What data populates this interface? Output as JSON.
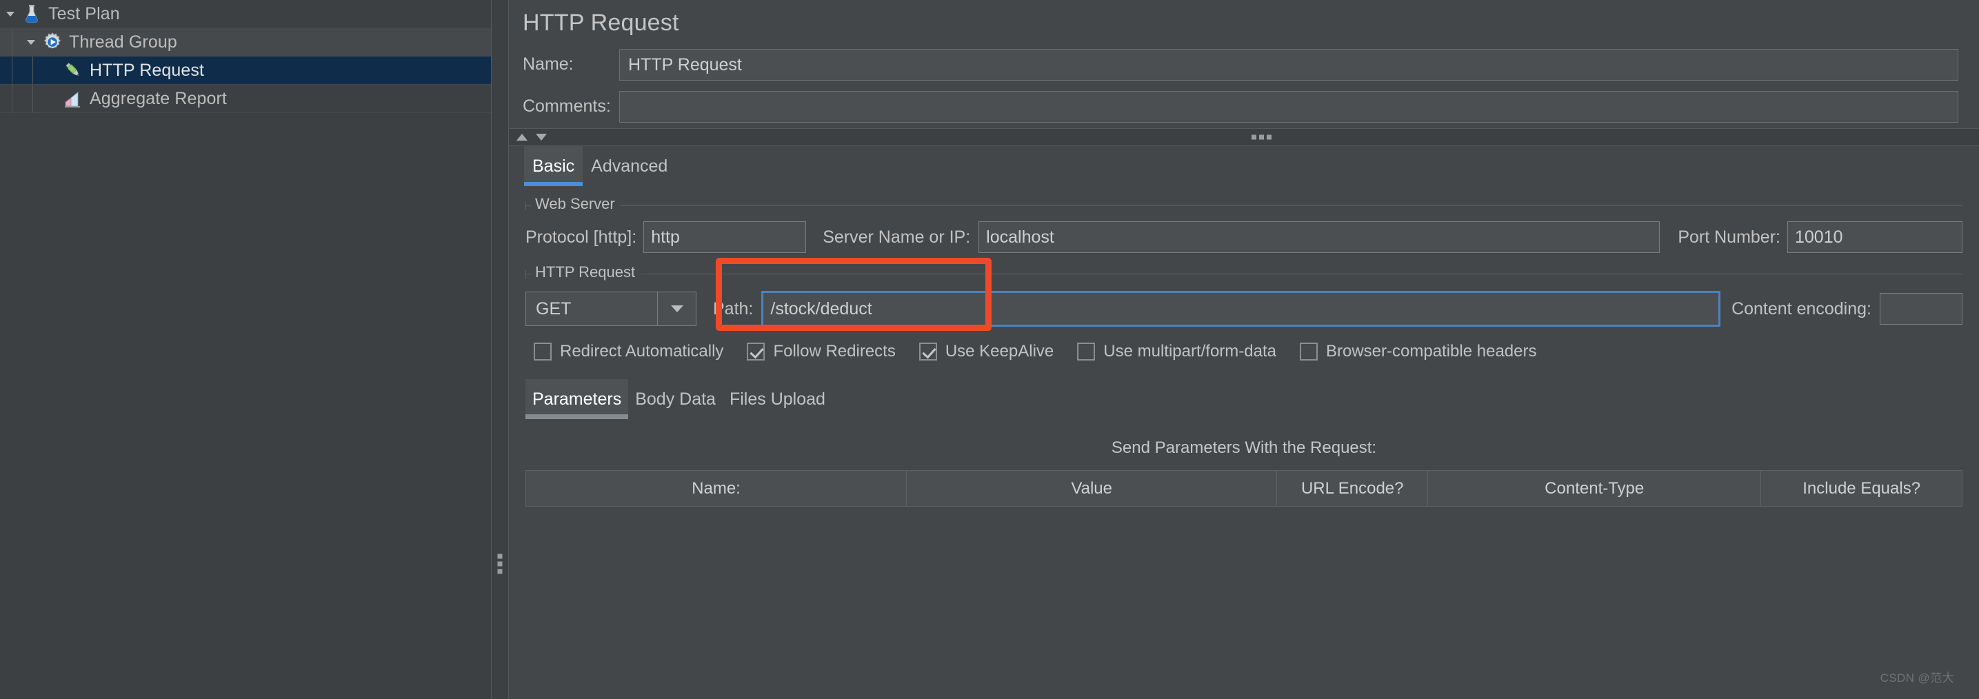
{
  "tree": {
    "items": [
      {
        "label": "Test Plan",
        "icon": "flask-icon",
        "depth": 0,
        "expanded": true,
        "selected": false
      },
      {
        "label": "Thread Group",
        "icon": "thread-group-gear-icon",
        "depth": 1,
        "expanded": true,
        "selected": false
      },
      {
        "label": "HTTP Request",
        "icon": "http-request-pen-icon",
        "depth": 2,
        "expanded": null,
        "selected": true
      },
      {
        "label": "Aggregate Report",
        "icon": "aggregate-report-chart-icon",
        "depth": 2,
        "expanded": null,
        "selected": false
      }
    ]
  },
  "panel": {
    "title": "HTTP Request",
    "name_label": "Name:",
    "name_value": "HTTP Request",
    "comments_label": "Comments:",
    "comments_value": ""
  },
  "tabs": {
    "items": [
      {
        "label": "Basic",
        "active": true
      },
      {
        "label": "Advanced",
        "active": false
      }
    ]
  },
  "web_server": {
    "group_title": "Web Server",
    "protocol_label": "Protocol [http]:",
    "protocol_value": "http",
    "server_label": "Server Name or IP:",
    "server_value": "localhost",
    "port_label": "Port Number:",
    "port_value": "10010"
  },
  "http_request": {
    "group_title": "HTTP Request",
    "method_value": "GET",
    "path_label": "Path:",
    "path_value": "/stock/deduct",
    "content_encoding_label": "Content encoding:",
    "content_encoding_value": ""
  },
  "checkboxes": [
    {
      "label": "Redirect Automatically",
      "checked": false
    },
    {
      "label": "Follow Redirects",
      "checked": true
    },
    {
      "label": "Use KeepAlive",
      "checked": true
    },
    {
      "label": "Use multipart/form-data",
      "checked": false
    },
    {
      "label": "Browser-compatible headers",
      "checked": false
    }
  ],
  "subtabs": {
    "items": [
      {
        "label": "Parameters",
        "active": true
      },
      {
        "label": "Body Data",
        "active": false
      },
      {
        "label": "Files Upload",
        "active": false
      }
    ]
  },
  "params_table": {
    "caption": "Send Parameters With the Request:",
    "columns": [
      "Name:",
      "Value",
      "URL Encode?",
      "Content-Type",
      "Include Equals?"
    ],
    "rows": []
  },
  "annotation": {
    "color": "#f0492a",
    "target": "path-field"
  },
  "watermark": "CSDN @范大",
  "colors": {
    "accent_blue": "#4b8ed8",
    "selection_blue": "#0f2d4a",
    "annotation_red": "#f0492a",
    "panel_bg": "#43474a",
    "tree_bg": "#3c4042"
  }
}
